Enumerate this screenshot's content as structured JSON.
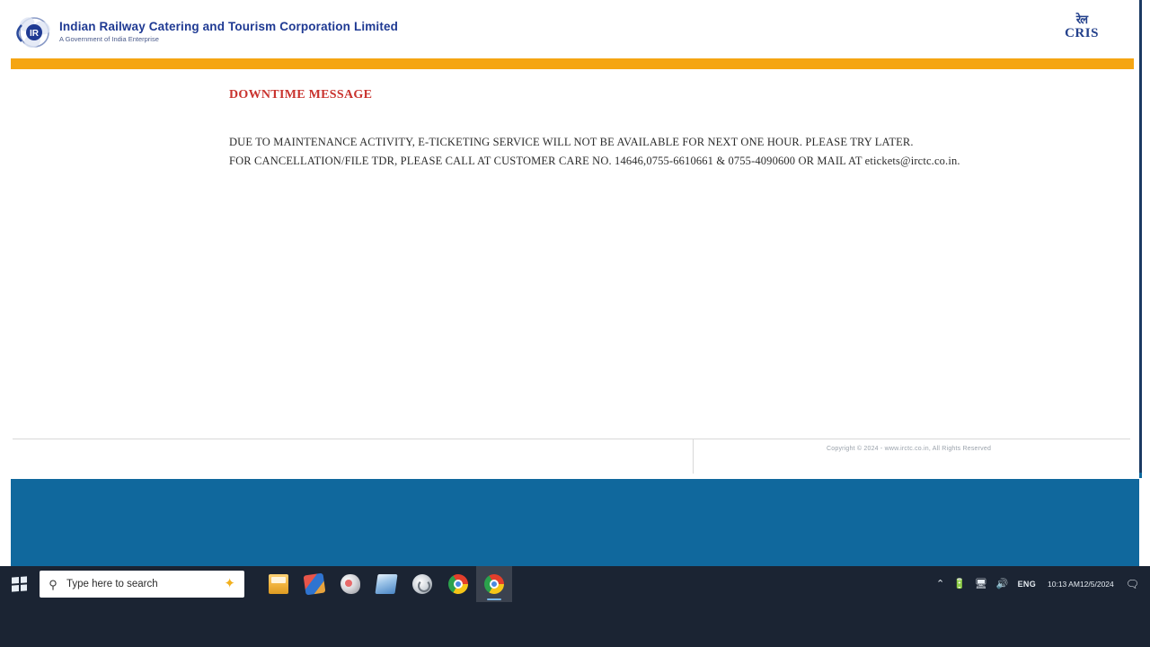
{
  "header": {
    "brand_title": "Indian Railway Catering and Tourism Corporation Limited",
    "brand_subtitle": "A Government of India Enterprise",
    "logo_icon": "irctc-logo-icon",
    "cris_mark": "रेल",
    "cris_text": "CRIS"
  },
  "content": {
    "downtime_title": "DOWNTIME MESSAGE",
    "message_line_1": "DUE TO MAINTENANCE ACTIVITY, E-TICKETING SERVICE WILL NOT BE AVAILABLE FOR NEXT ONE HOUR. PLEASE TRY LATER.",
    "message_line_2": "FOR CANCELLATION/FILE TDR, PLEASE CALL AT CUSTOMER CARE NO. 14646,0755-6610661 & 0755-4090600 OR MAIL AT etickets@irctc.co.in."
  },
  "footer": {
    "copyright": "Copyright © 2024 - www.irctc.co.in, All Rights Reserved"
  },
  "taskbar": {
    "start_icon": "windows-start-icon",
    "search": {
      "icon": "search-icon",
      "placeholder": "Type here to search",
      "sparkle_icon": "copilot-sparkle-icon"
    },
    "apps": [
      {
        "name": "file-explorer",
        "label": "File Explorer",
        "active": false
      },
      {
        "name": "office",
        "label": "Microsoft Office",
        "active": false
      },
      {
        "name": "paint",
        "label": "Paint",
        "active": false
      },
      {
        "name": "word",
        "label": "Word",
        "active": false
      },
      {
        "name": "edge",
        "label": "Microsoft Edge",
        "active": false
      },
      {
        "name": "chrome",
        "label": "Google Chrome",
        "active": false
      },
      {
        "name": "chrome-window",
        "label": "Google Chrome",
        "active": true
      }
    ],
    "tray": {
      "chevron": "⌃",
      "battery_icon": "battery-icon",
      "display_icon": "display-icon",
      "volume_icon": "volume-icon",
      "language": "ENG",
      "time": "10:13 AM",
      "date": "12/5/2024",
      "notification_icon": "notification-icon"
    }
  },
  "colors": {
    "brand_blue": "#1f3a93",
    "accent_orange": "#f5a512",
    "alert_red": "#c9332e",
    "panel_blue": "#10689d",
    "taskbar": "#1b2433"
  }
}
